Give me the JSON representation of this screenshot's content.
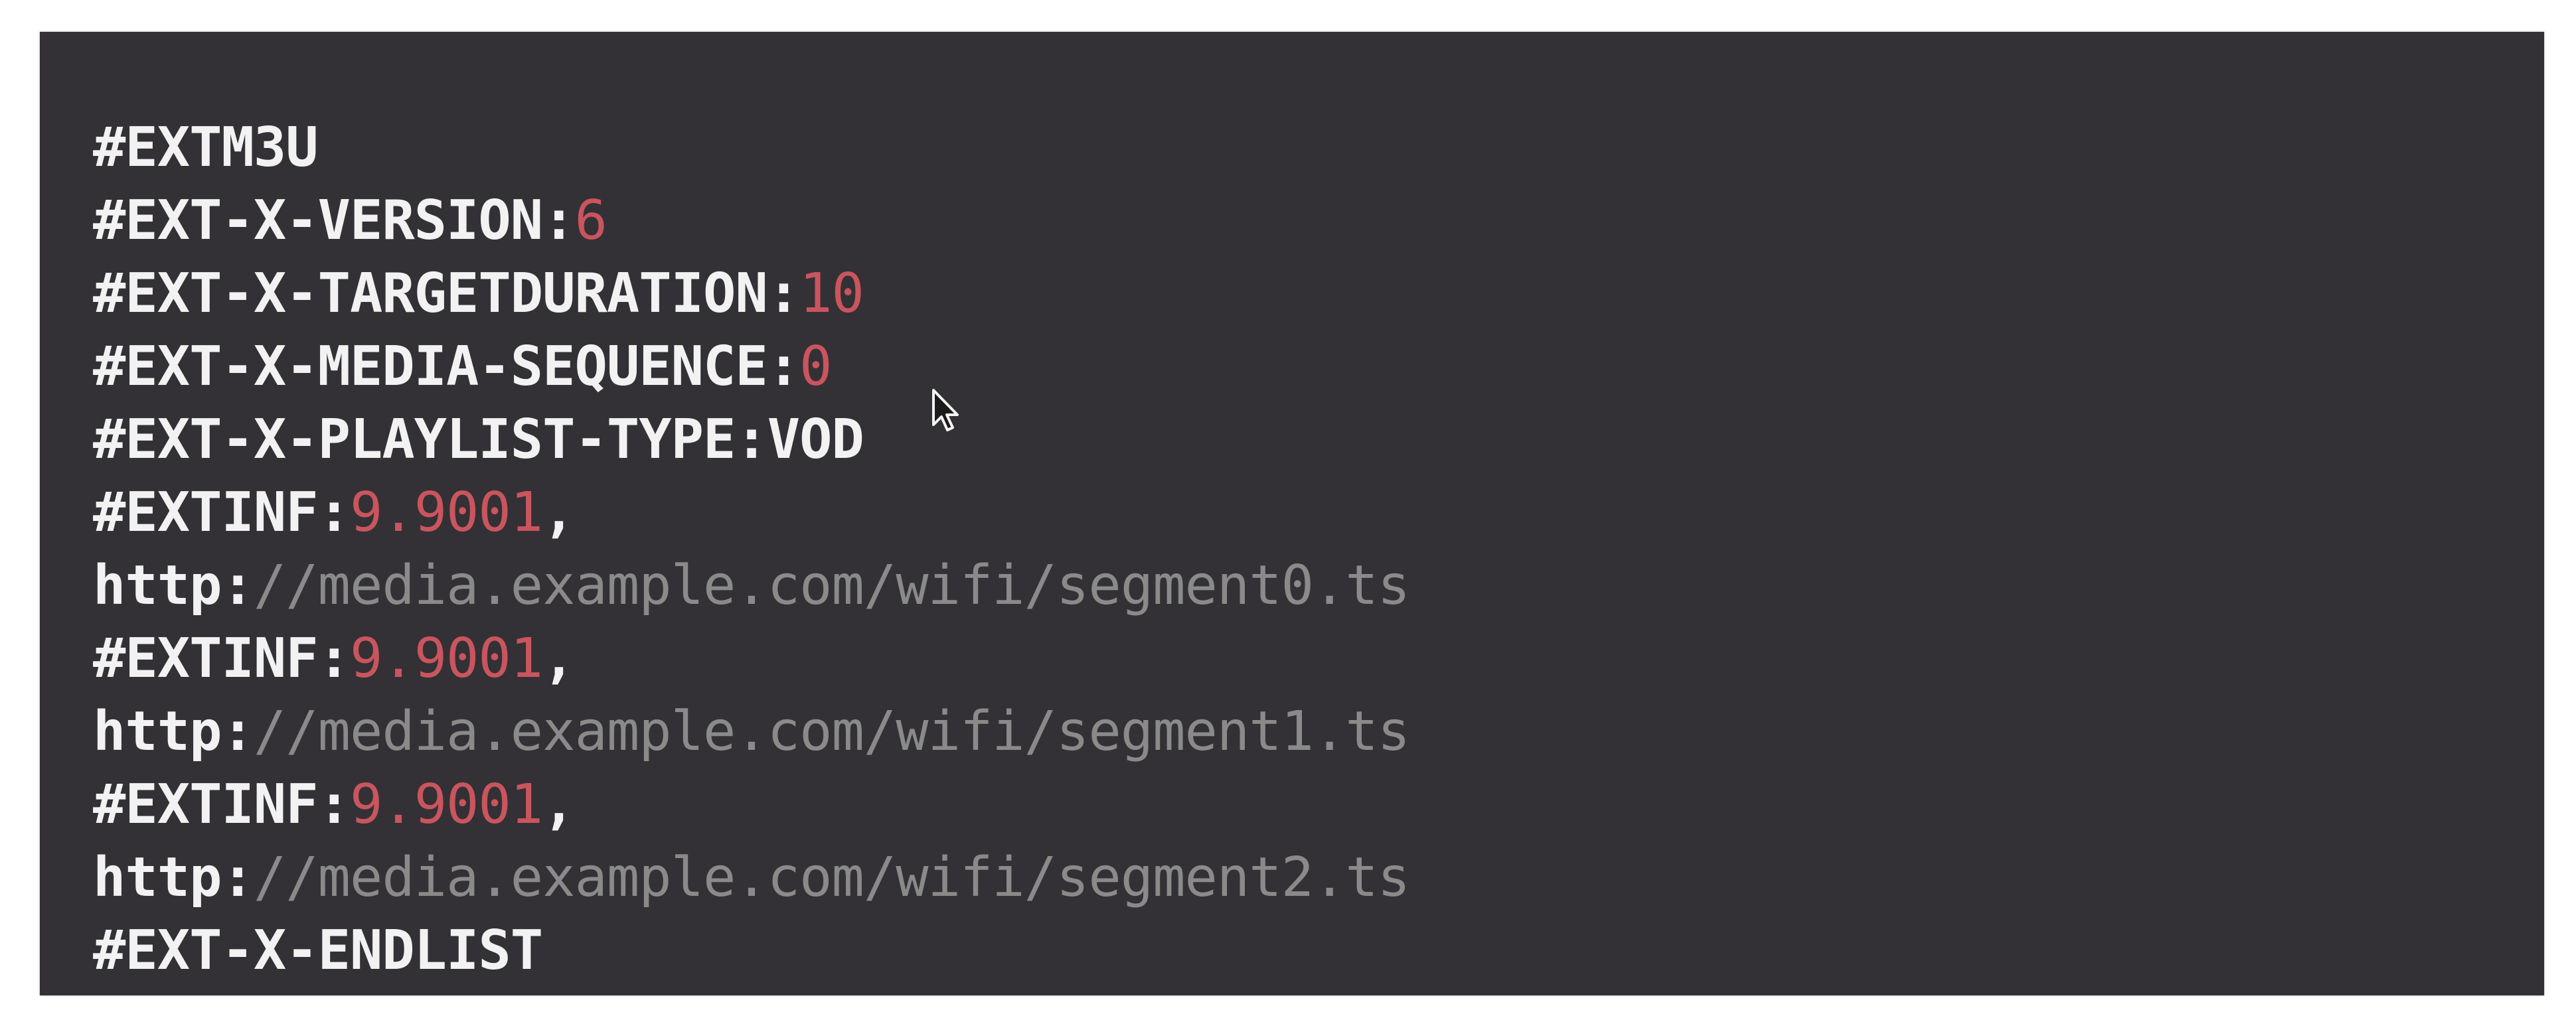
{
  "colors": {
    "panel_background": "#333135",
    "page_background": "#ffffff",
    "directive_text": "#f2f2f2",
    "numeric_value": "#c9555e",
    "url_path": "#8a8a8a"
  },
  "cursor_icon": "mouse-pointer-arrow-icon",
  "playlist": {
    "header": "#EXTM3U",
    "version": {
      "tag": "#EXT-X-VERSION:",
      "value": "6"
    },
    "target_duration": {
      "tag": "#EXT-X-TARGETDURATION:",
      "value": "10"
    },
    "media_sequence": {
      "tag": "#EXT-X-MEDIA-SEQUENCE:",
      "value": "0"
    },
    "playlist_type": "#EXT-X-PLAYLIST-TYPE:VOD",
    "segments": [
      {
        "inf_tag": "#EXTINF:",
        "duration": "9.9001",
        "comma": ",",
        "protocol": "http:",
        "path": "//media.example.com/wifi/segment0.ts"
      },
      {
        "inf_tag": "#EXTINF:",
        "duration": "9.9001",
        "comma": ",",
        "protocol": "http:",
        "path": "//media.example.com/wifi/segment1.ts"
      },
      {
        "inf_tag": "#EXTINF:",
        "duration": "9.9001",
        "comma": ",",
        "protocol": "http:",
        "path": "//media.example.com/wifi/segment2.ts"
      }
    ],
    "end": "#EXT-X-ENDLIST"
  }
}
